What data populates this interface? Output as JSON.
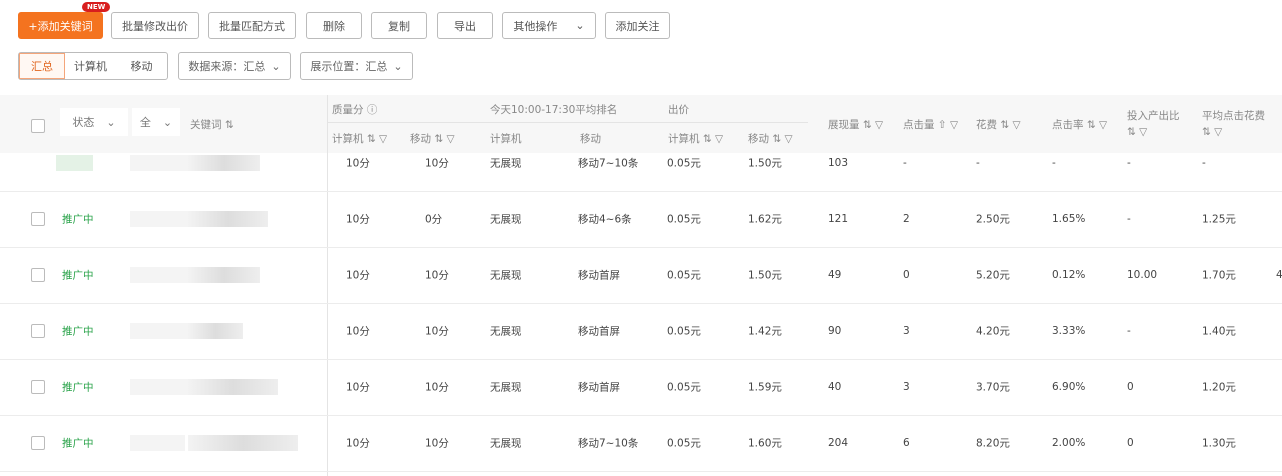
{
  "toolbar": {
    "add_keyword": "+添加关键词",
    "new_badge": "NEW",
    "batch_bid": "批量修改出价",
    "batch_match": "批量匹配方式",
    "delete": "删除",
    "copy": "复制",
    "export": "导出",
    "more_ops": "其他操作",
    "add_follow": "添加关注"
  },
  "filters": {
    "seg": [
      "汇总",
      "计算机",
      "移动"
    ],
    "data_source": "数据来源：汇总",
    "display_position": "展示位置：汇总"
  },
  "header": {
    "status": "状态",
    "all": "全",
    "keyword": "关键词 ⇅",
    "quality": "质量分 ⓘ",
    "rank": "今天10:00-17:30平均排名",
    "bid": "出价",
    "pc_sort": "计算机 ⇅ ▽",
    "mobile_sort": "移动 ⇅ ▽",
    "pc": "计算机",
    "mobile": "移动",
    "impressions": "展现量 ⇅ ▽",
    "clicks": "点击量 ⇧ ▽",
    "cost": "花费 ⇅ ▽",
    "ctr": "点击率 ⇅ ▽",
    "roi": "投入产出比",
    "roi_sort": "⇅ ▽",
    "cpc": "平均点击花费",
    "cpc_sort": "⇅ ▽"
  },
  "rows": [
    {
      "status": "",
      "q_pc": "10分",
      "q_m": "10分",
      "r_pc": "无展现",
      "r_m": "移动7~10条",
      "b_pc": "0.05元",
      "b_m": "1.50元",
      "imp": "103",
      "clk": "-",
      "cost": "-",
      "ctr": "-",
      "roi": "-",
      "cpc": "-",
      "extra": ""
    },
    {
      "status": "推广中",
      "q_pc": "10分",
      "q_m": "0分",
      "r_pc": "无展现",
      "r_m": "移动4~6条",
      "b_pc": "0.05元",
      "b_m": "1.62元",
      "imp": "121",
      "clk": "2",
      "cost": "2.50元",
      "ctr": "1.65%",
      "roi": "-",
      "cpc": "1.25元",
      "extra": ""
    },
    {
      "status": "推广中",
      "q_pc": "10分",
      "q_m": "10分",
      "r_pc": "无展现",
      "r_m": "移动首屏",
      "b_pc": "0.05元",
      "b_m": "1.50元",
      "imp": "49",
      "clk": "0",
      "cost": "5.20元",
      "ctr": "0.12%",
      "roi": "10.00",
      "cpc": "1.70元",
      "extra": "4"
    },
    {
      "status": "推广中",
      "q_pc": "10分",
      "q_m": "10分",
      "r_pc": "无展现",
      "r_m": "移动首屏",
      "b_pc": "0.05元",
      "b_m": "1.42元",
      "imp": "90",
      "clk": "3",
      "cost": "4.20元",
      "ctr": "3.33%",
      "roi": "-",
      "cpc": "1.40元",
      "extra": ""
    },
    {
      "status": "推广中",
      "q_pc": "10分",
      "q_m": "10分",
      "r_pc": "无展现",
      "r_m": "移动首屏",
      "b_pc": "0.05元",
      "b_m": "1.59元",
      "imp": "40",
      "clk": "3",
      "cost": "3.70元",
      "ctr": "6.90%",
      "roi": "0",
      "cpc": "1.20元",
      "extra": ""
    },
    {
      "status": "推广中",
      "q_pc": "10分",
      "q_m": "10分",
      "r_pc": "无展现",
      "r_m": "移动7~10条",
      "b_pc": "0.05元",
      "b_m": "1.60元",
      "imp": "204",
      "clk": "6",
      "cost": "8.20元",
      "ctr": "2.00%",
      "roi": "0",
      "cpc": "1.30元",
      "extra": ""
    }
  ]
}
